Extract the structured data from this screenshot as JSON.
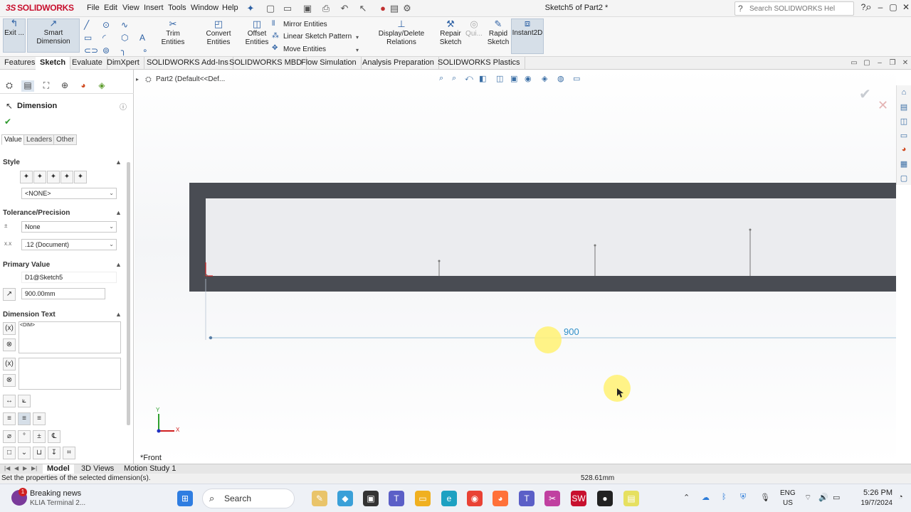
{
  "app": {
    "logo_text": "SOLIDWORKS",
    "logo_prefix": "3S",
    "doc_title": "Sketch5 of Part2 *",
    "menu": [
      "File",
      "Edit",
      "View",
      "Insert",
      "Tools",
      "Window",
      "Help"
    ],
    "search_placeholder": "Search SOLIDWORKS Help"
  },
  "toolbar": {
    "exit_label": "Exit ...",
    "smart_dimension": "Smart Dimension",
    "trim_entities": "Trim Entities",
    "convert_entities": "Convert Entities",
    "offset_entities_1": "Offset",
    "offset_entities_2": "Entities",
    "mirror_entities": "Mirror Entities",
    "linear_sketch_pattern": "Linear Sketch Pattern",
    "move_entities": "Move Entities",
    "display_delete_relations": "Display/Delete Relations",
    "repair_sketch_1": "Repair",
    "repair_sketch_2": "Sketch",
    "quick_snaps": "Qui...",
    "rapid_sketch_1": "Rapid",
    "rapid_sketch_2": "Sketch",
    "instant2d": "Instant2D"
  },
  "tabs": [
    "Features",
    "Sketch",
    "Evaluate",
    "DimXpert",
    "SOLIDWORKS Add-Ins",
    "SOLIDWORKS MBD",
    "Flow Simulation",
    "Analysis Preparation",
    "SOLIDWORKS Plastics"
  ],
  "active_tab": "Sketch",
  "property_manager": {
    "title": "Dimension",
    "subtabs": [
      "Value",
      "Leaders",
      "Other"
    ],
    "style_header": "Style",
    "style_select": "<NONE>",
    "tolerance_header": "Tolerance/Precision",
    "tolerance_type": "None",
    "precision": ".12 (Document)",
    "primary_value_header": "Primary Value",
    "dimension_name": "D1@Sketch5",
    "dimension_value": "900.00mm",
    "dimension_text_header": "Dimension Text",
    "dim_token": "<DIM>"
  },
  "graphics": {
    "tree_root": "Part2  (Default<<Def...",
    "view_label": "*Front",
    "dimension_label": "900"
  },
  "bottom_tabs": [
    "Model",
    "3D Views",
    "Motion Study 1"
  ],
  "status": {
    "message": "Set the properties of the selected dimension(s).",
    "coordinate": "528.61mm"
  },
  "taskbar": {
    "news_title": "Breaking news",
    "news_sub": "KLIA Terminal 2...",
    "news_badge": "1",
    "search_label": "Search",
    "lang_1": "ENG",
    "lang_2": "US",
    "time": "5:26 PM",
    "date": "19/7/2024"
  },
  "colors": {
    "accent": "#2b5fa3",
    "brand": "#c8102e",
    "part_fill": "#494c53",
    "dimension": "#2f8fc9",
    "highlight": "#fff27a"
  }
}
